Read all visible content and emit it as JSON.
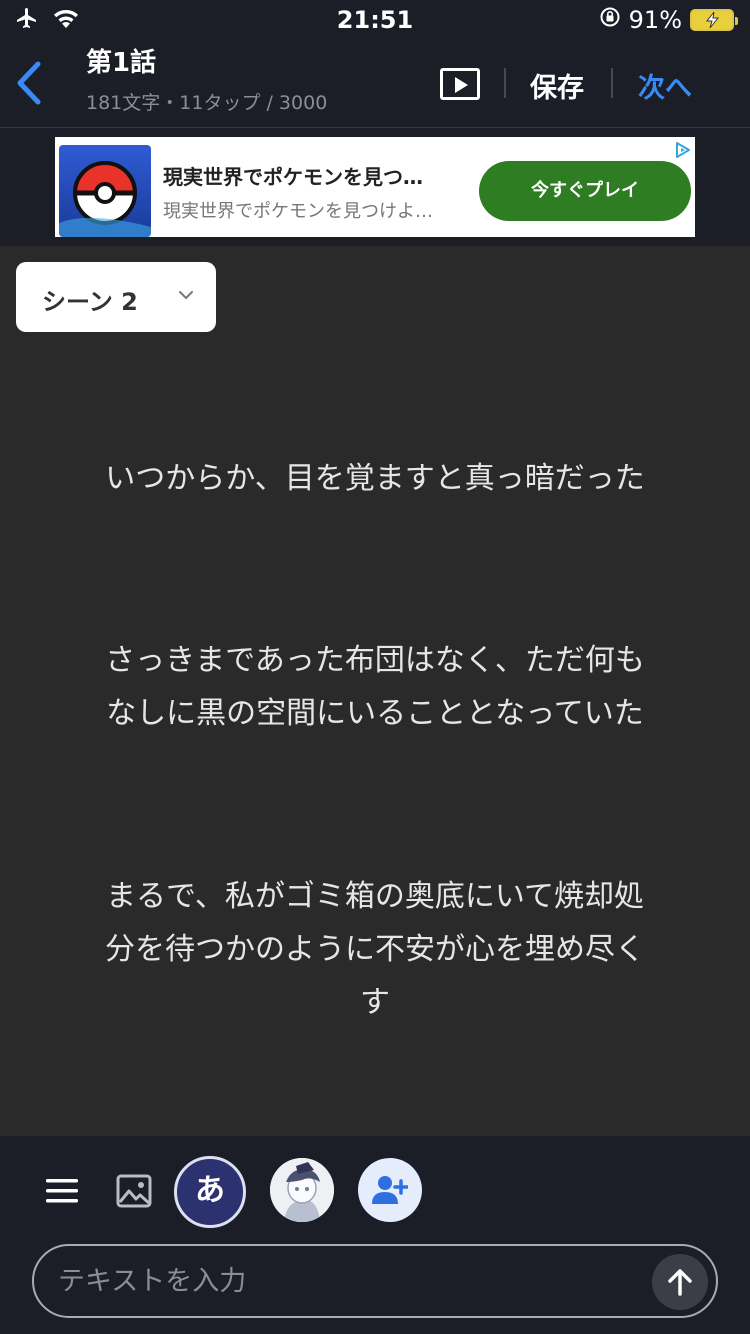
{
  "status_bar": {
    "time": "21:51",
    "battery_percent": "91%"
  },
  "header": {
    "title": "第1話",
    "subtitle": "181文字・11タップ / 3000",
    "save_label": "保存",
    "next_label": "次へ"
  },
  "ad": {
    "title": "現実世界でポケモンを見つ…",
    "description": "現実世界でポケモンを見つけよ…",
    "cta": "今すぐプレイ"
  },
  "scene_selector": {
    "label": "シーン 2"
  },
  "story": {
    "paragraphs": [
      [
        "いつからか、目を覚ますと真っ暗だった"
      ],
      [
        "さっきまであった布団はなく、ただ何も",
        "なしに黒の空間にいることとなっていた"
      ],
      [
        "まるで、私がゴミ箱の奥底にいて焼却処",
        "分を待つかのように不安が心を埋め尽く",
        "す"
      ]
    ]
  },
  "toolbar": {
    "hiragana_label": "あ",
    "input_placeholder": "テキストを入力"
  },
  "colors": {
    "background": "#1b1d27",
    "canvas": "#2a2a2a",
    "accent": "#3a8af5",
    "ad_cta": "#2e7d22",
    "char_button": "#2c3170"
  },
  "icons": [
    "airplane-icon",
    "wifi-icon",
    "rotation-lock-icon",
    "battery-charging-icon",
    "back-chevron-icon",
    "play-icon",
    "adchoices-icon",
    "chevron-down-icon",
    "menu-icon",
    "image-icon",
    "add-user-icon",
    "send-arrow-icon"
  ]
}
